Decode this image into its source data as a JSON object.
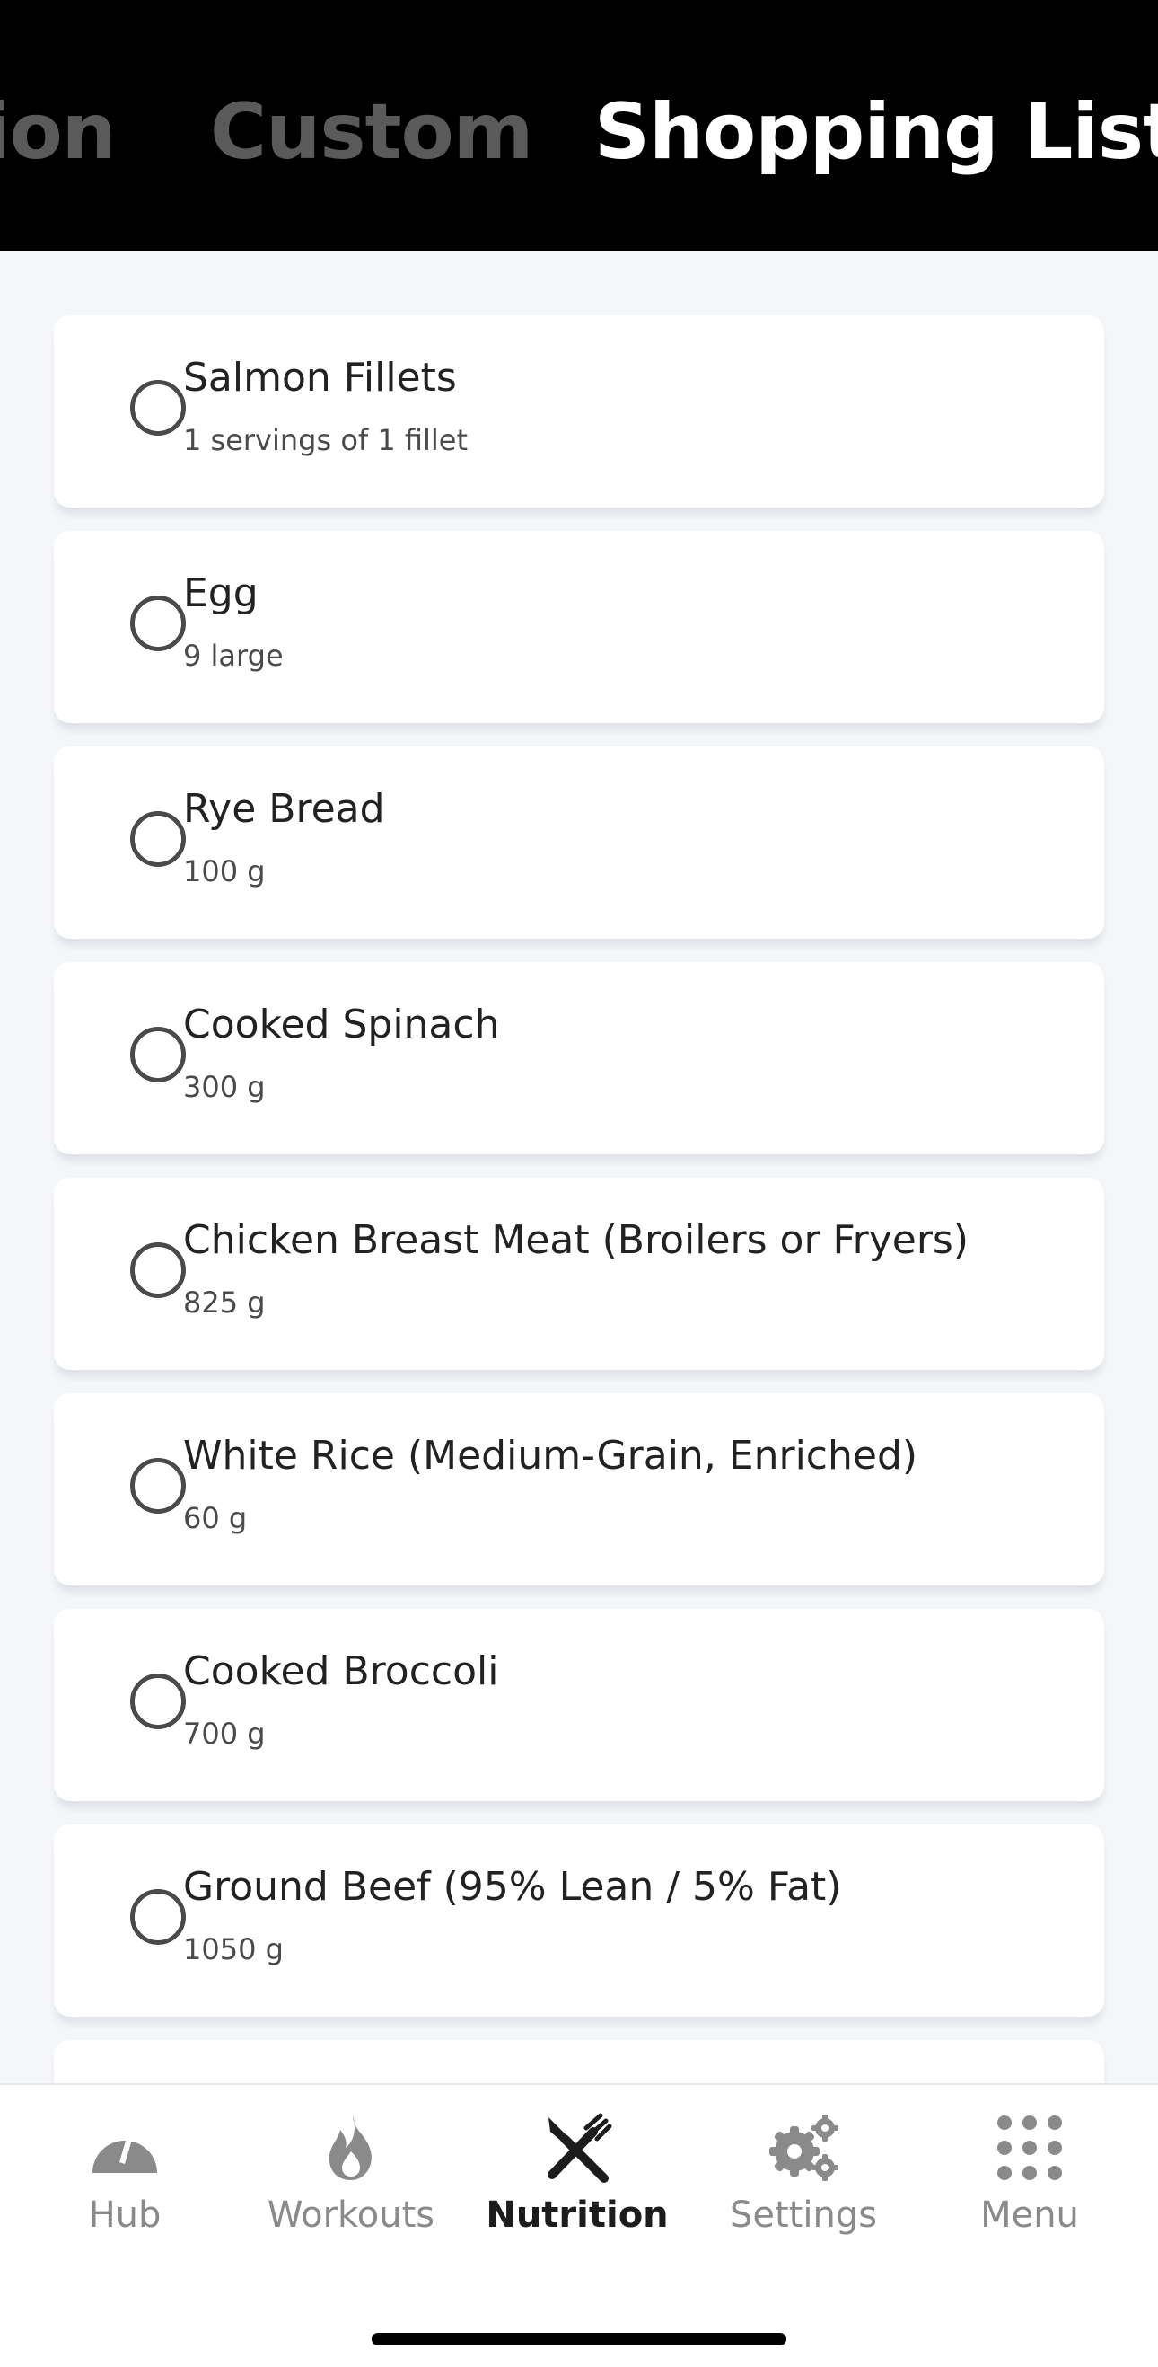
{
  "header": {
    "tabs": [
      {
        "label": "tion",
        "active": false
      },
      {
        "label": "Custom",
        "active": false
      },
      {
        "label": "Shopping List",
        "active": true
      }
    ]
  },
  "shopping_list": {
    "items": [
      {
        "name": "Salmon Fillets",
        "quantity": "1 servings of 1 fillet",
        "checked": false
      },
      {
        "name": "Egg",
        "quantity": "9 large",
        "checked": false
      },
      {
        "name": "Rye Bread",
        "quantity": "100 g",
        "checked": false
      },
      {
        "name": "Cooked Spinach",
        "quantity": "300 g",
        "checked": false
      },
      {
        "name": "Chicken Breast Meat (Broilers or Fryers)",
        "quantity": "825 g",
        "checked": false
      },
      {
        "name": "White Rice (Medium-Grain, Enriched)",
        "quantity": "60 g",
        "checked": false
      },
      {
        "name": "Cooked Broccoli",
        "quantity": "700 g",
        "checked": false
      },
      {
        "name": "Ground Beef (95% Lean / 5% Fat)",
        "quantity": "1050 g",
        "checked": false
      }
    ]
  },
  "tabbar": {
    "items": [
      {
        "label": "Hub",
        "icon": "gauge-icon",
        "active": false
      },
      {
        "label": "Workouts",
        "icon": "flame-icon",
        "active": false
      },
      {
        "label": "Nutrition",
        "icon": "fork-knife-icon",
        "active": true
      },
      {
        "label": "Settings",
        "icon": "gears-icon",
        "active": false
      },
      {
        "label": "Menu",
        "icon": "grid-dots-icon",
        "active": false
      }
    ]
  },
  "colors": {
    "header_bg": "#000000",
    "active_tab": "#ffffff",
    "inactive_tab": "#5a5a5a",
    "page_bg": "#f5f6fa",
    "card_bg": "#ffffff",
    "tab_inactive": "#8a8a8a",
    "tab_active": "#1c1c1c"
  }
}
